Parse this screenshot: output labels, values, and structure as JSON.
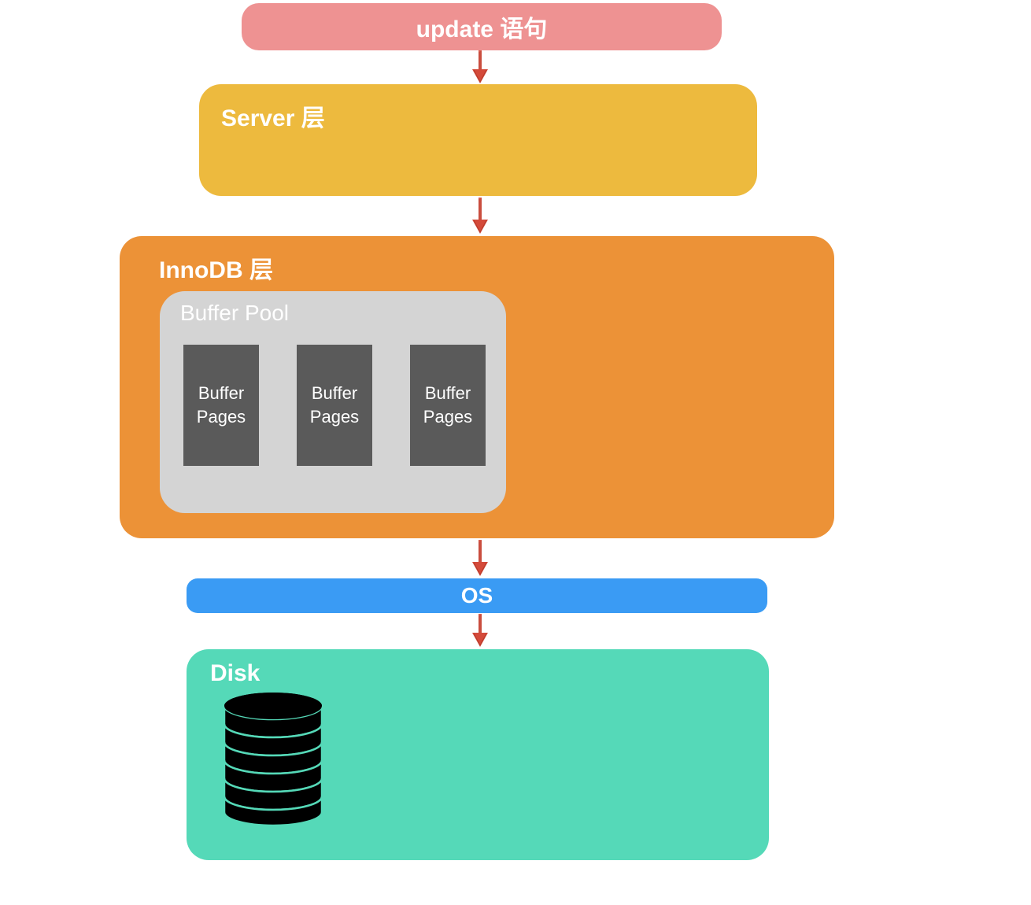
{
  "update": {
    "label": "update 语句"
  },
  "server": {
    "label": "Server 层"
  },
  "innodb": {
    "label": "InnoDB 层",
    "bufferPool": {
      "label": "Buffer Pool",
      "pages": [
        "Buffer Pages",
        "Buffer Pages",
        "Buffer Pages"
      ]
    }
  },
  "os": {
    "label": "OS"
  },
  "disk": {
    "label": "Disk"
  },
  "colors": {
    "update": "#ee9292",
    "server": "#edba3e",
    "innodb": "#ec9237",
    "bufferPool": "#d4d4d4",
    "bufferPage": "#5a5a5a",
    "os": "#3a9bf4",
    "disk": "#55d9b8",
    "arrow": "#d44a3a"
  }
}
